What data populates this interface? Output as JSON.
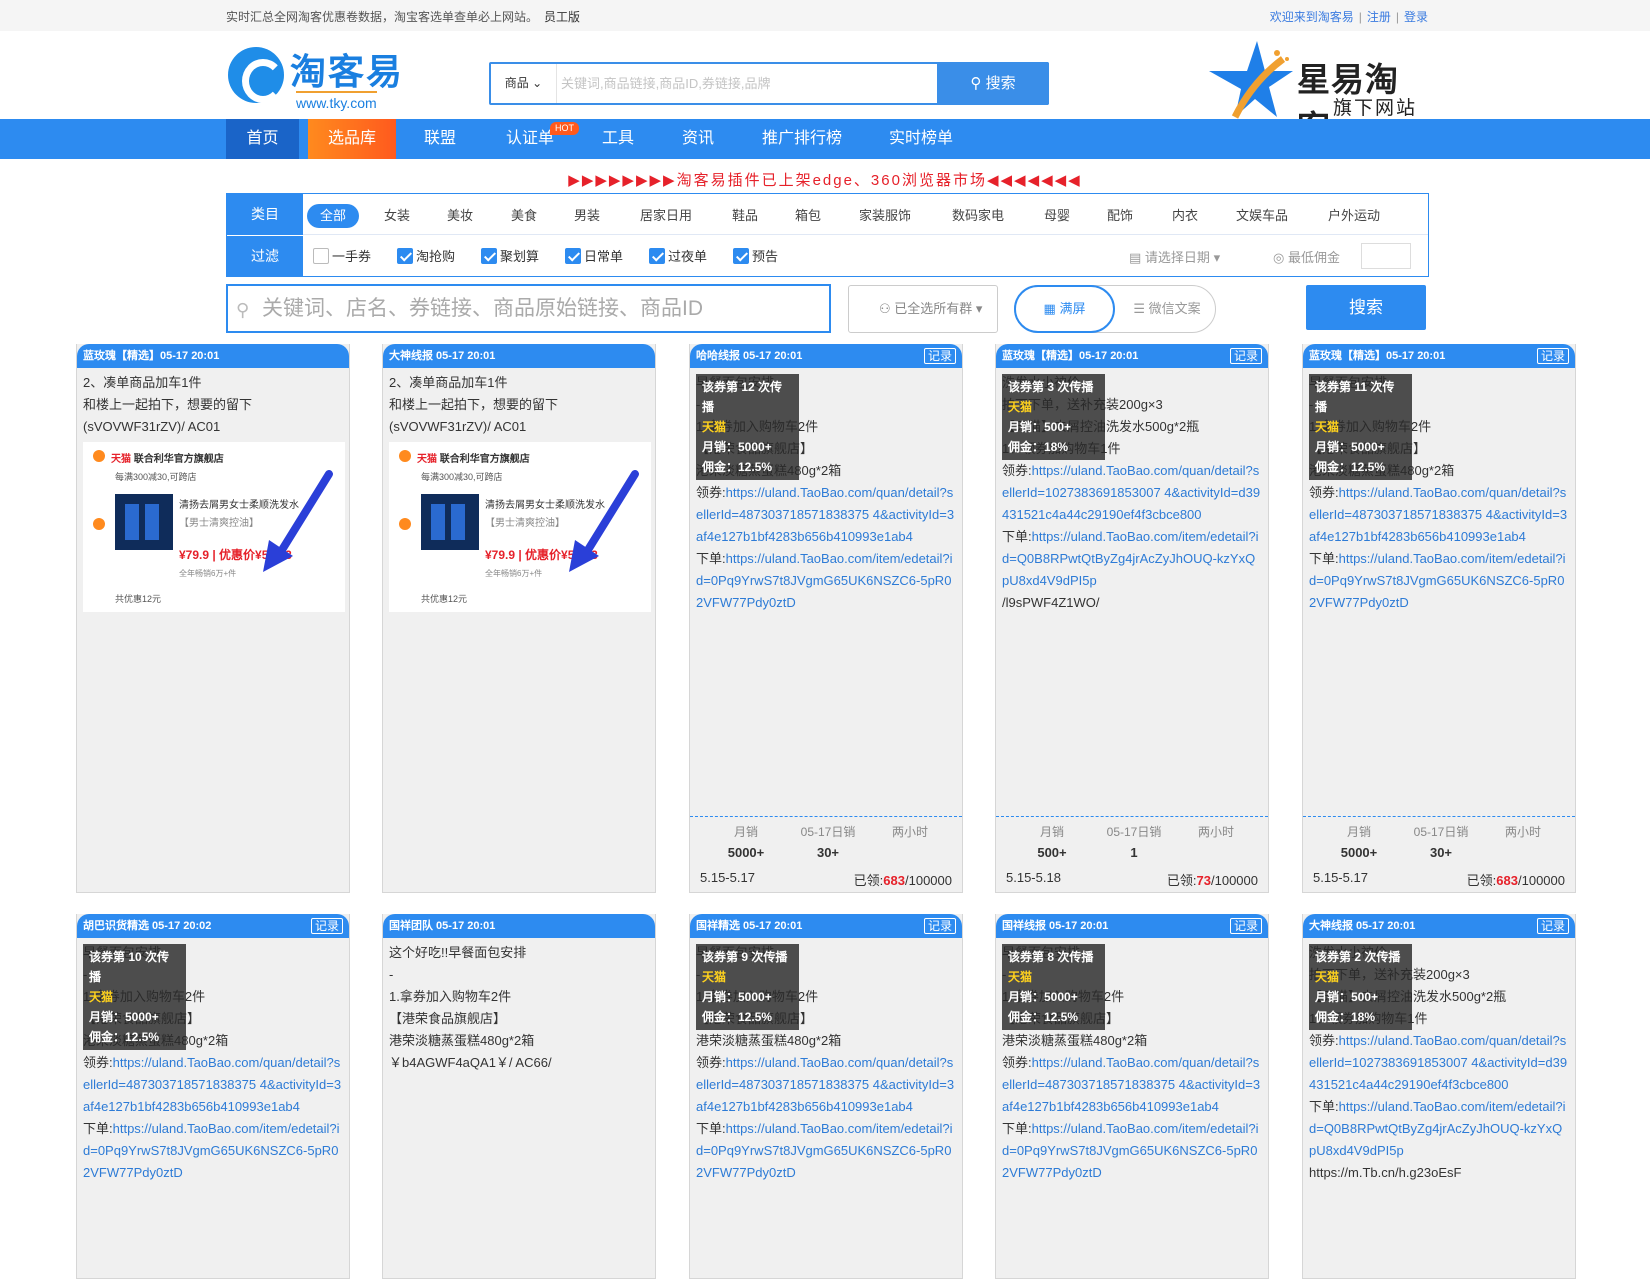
{
  "topbar": {
    "notice": "实时汇总全网淘客优惠卷数据，淘宝客选单查单必上网站。",
    "edition": "员工版",
    "welcome": "欢迎来到淘客易",
    "register": "注册",
    "login": "登录"
  },
  "header": {
    "logo_name": "淘客易",
    "logo_url": "www.tky.com",
    "search_category": "商品",
    "search_placeholder": "关键词,商品链接,商品ID,券链接,品牌",
    "search_button": "搜索",
    "brand_title": "星易淘客",
    "brand_subtitle": "旗下网站"
  },
  "nav": {
    "items": [
      "首页",
      "选品库",
      "联盟",
      "认证单",
      "工具",
      "资讯",
      "推广排行榜",
      "实时榜单"
    ],
    "hot_badge": "HOT"
  },
  "marquee": "▶▶▶▶▶▶▶▶淘客易插件已上架edge、360浏览器市场◀◀◀◀◀◀◀",
  "filter": {
    "category_label": "类目",
    "categories": [
      "全部",
      "女装",
      "美妆",
      "美食",
      "男装",
      "居家日用",
      "鞋品",
      "箱包",
      "家装服饰",
      "数码家电",
      "母婴",
      "配饰",
      "内衣",
      "文娱车品",
      "户外运动"
    ],
    "filter_label": "过滤",
    "checks": [
      {
        "label": "一手券",
        "checked": false
      },
      {
        "label": "淘抢购",
        "checked": true
      },
      {
        "label": "聚划算",
        "checked": true
      },
      {
        "label": "日常单",
        "checked": true
      },
      {
        "label": "过夜单",
        "checked": true
      },
      {
        "label": "预告",
        "checked": true
      }
    ],
    "date_placeholder": "请选择日期",
    "min_commission": "最低佣金"
  },
  "search2": {
    "placeholder": "关键词、店名、券链接、商品原始链接、商品ID",
    "group_select": "已全选所有群",
    "mode_full": "满屏",
    "mode_wechat": "微信文案",
    "button": "搜索"
  },
  "common": {
    "record": "记录",
    "stat_month": "月销",
    "stat_day": "05-17日销",
    "stat_2h": "两小时",
    "claimed": "已领:"
  },
  "cards": [
    {
      "header": "蓝玫瑰【精选】05-17 20:01",
      "lines": [
        {
          "t": "2、凑单商品加车1件"
        },
        {
          "t": "和楼上一起拍下，想要的留下"
        },
        {
          "t": "(sVOVWF31rZV)/ AC01"
        }
      ],
      "shot": {
        "store": "天猫",
        "store_name": "联合利华官方旗舰店",
        "promo": "每满300减30,可跨店",
        "title": "清扬去屑男女士柔顺洗发水",
        "sub": "【男士清爽控油】",
        "price": "¥79.9 | 优惠价¥59.93",
        "sales": "全年畅销6万+件",
        "saving": "共优惠12元"
      }
    },
    {
      "header": "大神线报 05-17 20:01",
      "lines": [
        {
          "t": "2、凑单商品加车1件"
        },
        {
          "t": "和楼上一起拍下，想要的留下"
        },
        {
          "t": "(sVOVWF31rZV)/ AC01"
        }
      ],
      "shot": {
        "store": "天猫",
        "store_name": "联合利华官方旗舰店",
        "promo": "每满300减30,可跨店",
        "title": "清扬去屑男女士柔顺洗发水",
        "sub": "【男士清爽控油】",
        "price": "¥79.9 | 优惠价¥59.93",
        "sales": "全年畅销6万+件",
        "saving": "共优惠12元"
      }
    },
    {
      "header": "哈哈线报 05-17 20:01",
      "record": true,
      "overlay": {
        "spread": "该券第 12 次传播",
        "platform": "天猫",
        "sales": "月销：5000+",
        "commission": "佣金：12.5%"
      },
      "lines": [
        {
          "t": "早餐面包安排"
        },
        {
          "t": "-"
        },
        {
          "t": "1.拿券加入购物车2件"
        },
        {
          "t": "【港荣食品旗舰店】"
        },
        {
          "t": "港荣淡糖蒸蛋糕480g*2箱"
        },
        {
          "p": "领券:",
          "l": "https://uland.TaoBao.com/quan/detail?sellerId=487303718571838375 4&activityId=3af4e127b1bf4283b656b410993e1ab4"
        },
        {
          "p": "下单:",
          "l": "https://uland.TaoBao.com/item/edetail?id=0Pq9YrwS7t8JVgmG65UK6NSZC6-5pR02VFW77Pdy0ztD"
        }
      ],
      "stats": {
        "month": "5000+",
        "day": "30+",
        "two_hours": "",
        "dates": "5.15-5.17",
        "claimed": "683",
        "total": "/100000"
      }
    },
    {
      "header": "蓝玫瑰【精选】05-17 20:01",
      "record": true,
      "overlay": {
        "spread": "该券第 3 次传播",
        "platform": "天猫",
        "sales": "月销：500+",
        "commission": "佣金：18%"
      },
      "lines": [
        {
          "t": "洗发水小神价"
        },
        {
          "t": "拍下下单，送补充装200g×3"
        },
        {
          "t": "【天猫】去屑控油洗发水500g*2瓶"
        },
        {
          "t": "1、领券加购物车1件"
        },
        {
          "p": "领券:",
          "l": "https://uland.TaoBao.com/quan/detail?sellerId=1027383691853007 4&activityId=d39431521c4a44c29190ef4f3cbce800"
        },
        {
          "p": "下单:",
          "l": "https://uland.TaoBao.com/item/edetail?id=Q0B8RPwtQtByZg4jrAcZyJhOUQ-kzYxQpU8xd4V9dPI5p"
        },
        {
          "t": "/l9sPWF4Z1WO/"
        }
      ],
      "stats": {
        "month": "500+",
        "day": "1",
        "two_hours": "",
        "dates": "5.15-5.18",
        "claimed": "73",
        "total": "/100000"
      }
    },
    {
      "header": "蓝玫瑰【精选】05-17 20:01",
      "record": true,
      "overlay": {
        "spread": "该券第 11 次传播",
        "platform": "天猫",
        "sales": "月销：5000+",
        "commission": "佣金：12.5%"
      },
      "lines": [
        {
          "t": "早餐面包安排"
        },
        {
          "t": "-"
        },
        {
          "t": "1.拿券加入购物车2件"
        },
        {
          "t": "【港荣食品旗舰店】"
        },
        {
          "t": "港荣淡糖蒸蛋糕480g*2箱"
        },
        {
          "p": "领券:",
          "l": "https://uland.TaoBao.com/quan/detail?sellerId=487303718571838375 4&activityId=3af4e127b1bf4283b656b410993e1ab4"
        },
        {
          "p": "下单:",
          "l": "https://uland.TaoBao.com/item/edetail?id=0Pq9YrwS7t8JVgmG65UK6NSZC6-5pR02VFW77Pdy0ztD"
        }
      ],
      "stats": {
        "month": "5000+",
        "day": "30+",
        "two_hours": "",
        "dates": "5.15-5.17",
        "claimed": "683",
        "total": "/100000"
      }
    },
    {
      "header": "胡巴识货精选 05-17 20:02",
      "record": true,
      "overlay": {
        "spread": "该券第 10 次传播",
        "platform": "天猫",
        "sales": "月销：5000+",
        "commission": "佣金：12.5%"
      },
      "lines": [
        {
          "t": "早餐面包安排"
        },
        {
          "t": "-"
        },
        {
          "t": "1.拿券加入购物车2件"
        },
        {
          "t": "【港荣食品旗舰店】"
        },
        {
          "t": "港荣淡糖蒸蛋糕480g*2箱"
        },
        {
          "p": "领券:",
          "l": "https://uland.TaoBao.com/quan/detail?sellerId=487303718571838375 4&activityId=3af4e127b1bf4283b656b410993e1ab4"
        },
        {
          "p": "下单:",
          "l": "https://uland.TaoBao.com/item/edetail?id=0Pq9YrwS7t8JVgmG65UK6NSZC6-5pR02VFW77Pdy0ztD"
        }
      ]
    },
    {
      "header": "国祥团队 05-17 20:01",
      "lines": [
        {
          "t": "这个好吃!!早餐面包安排"
        },
        {
          "t": "-"
        },
        {
          "t": "1.拿券加入购物车2件"
        },
        {
          "t": "【港荣食品旗舰店】"
        },
        {
          "t": "港荣淡糖蒸蛋糕480g*2箱"
        },
        {
          "t": "￥b4AGWF4aQA1￥/ AC66/"
        }
      ]
    },
    {
      "header": "国祥精选 05-17 20:01",
      "record": true,
      "overlay": {
        "spread": "该券第 9 次传播",
        "platform": "天猫",
        "sales": "月销：5000+",
        "commission": "佣金：12.5%"
      },
      "lines": [
        {
          "t": "早餐面包安排"
        },
        {
          "t": "-"
        },
        {
          "t": "1.拿券加入购物车2件"
        },
        {
          "t": "【港荣食品旗舰店】"
        },
        {
          "t": "港荣淡糖蒸蛋糕480g*2箱"
        },
        {
          "p": "领券:",
          "l": "https://uland.TaoBao.com/quan/detail?sellerId=487303718571838375 4&activityId=3af4e127b1bf4283b656b410993e1ab4"
        },
        {
          "p": "下单:",
          "l": "https://uland.TaoBao.com/item/edetail?id=0Pq9YrwS7t8JVgmG65UK6NSZC6-5pR02VFW77Pdy0ztD"
        }
      ]
    },
    {
      "header": "国祥线报 05-17 20:01",
      "record": true,
      "overlay": {
        "spread": "该券第 8 次传播",
        "platform": "天猫",
        "sales": "月销：5000+",
        "commission": "佣金：12.5%"
      },
      "lines": [
        {
          "t": "早餐面包安排"
        },
        {
          "t": "-"
        },
        {
          "t": "1.拿券加入购物车2件"
        },
        {
          "t": "【港荣食品旗舰店】"
        },
        {
          "t": "港荣淡糖蒸蛋糕480g*2箱"
        },
        {
          "p": "领券:",
          "l": "https://uland.TaoBao.com/quan/detail?sellerId=487303718571838375 4&activityId=3af4e127b1bf4283b656b410993e1ab4"
        },
        {
          "p": "下单:",
          "l": "https://uland.TaoBao.com/item/edetail?id=0Pq9YrwS7t8JVgmG65UK6NSZC6-5pR02VFW77Pdy0ztD"
        }
      ]
    },
    {
      "header": "大神线报 05-17 20:01",
      "record": true,
      "overlay": {
        "spread": "该券第 2 次传播",
        "platform": "天猫",
        "sales": "月销：500+",
        "commission": "佣金：18%"
      },
      "lines": [
        {
          "t": "洗发水小神价"
        },
        {
          "t": "拍下下单，送补充装200g×3"
        },
        {
          "t": "【天猫】去屑控油洗发水500g*2瓶"
        },
        {
          "t": "1、领券加购物车1件"
        },
        {
          "p": "领券:",
          "l": "https://uland.TaoBao.com/quan/detail?sellerId=1027383691853007 4&activityId=d39431521c4a44c29190ef4f3cbce800"
        },
        {
          "p": "下单:",
          "l": "https://uland.TaoBao.com/item/edetail?id=Q0B8RPwtQtByZg4jrAcZyJhOUQ-kzYxQpU8xd4V9dPI5p"
        },
        {
          "t": "https://m.Tb.cn/h.g23oEsF"
        }
      ]
    }
  ]
}
